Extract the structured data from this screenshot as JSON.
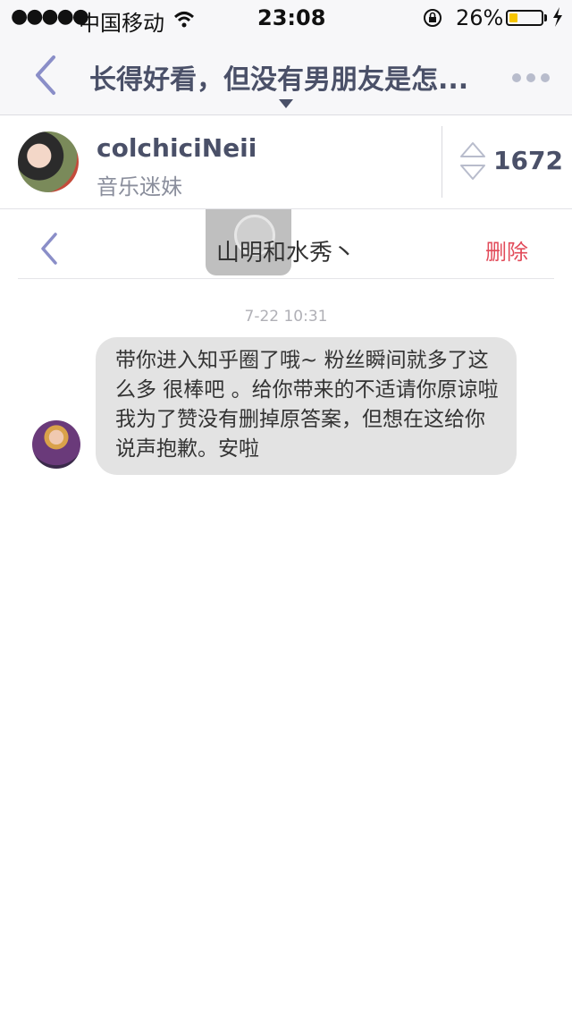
{
  "status_bar": {
    "signal": "●●●●●",
    "carrier": "中国移动",
    "time": "23:08",
    "battery_percent": "26%",
    "battery_level": 0.26,
    "icons": [
      "wifi-icon",
      "rotation-lock-icon",
      "battery-icon",
      "charging-icon"
    ]
  },
  "nav": {
    "title": "长得好看，但没有男朋友是怎...",
    "icons": [
      "back-chevron-icon",
      "caret-down-icon",
      "more-icon"
    ]
  },
  "author": {
    "name": "colchiciNeii",
    "bio": "音乐迷妹",
    "vote_count": "1672"
  },
  "message_sheet": {
    "recipient": "山明和水秀丶",
    "delete_label": "删除"
  },
  "conversation": {
    "timestamp": "7-22 10:31",
    "message": "带你进入知乎圈了哦~  粉丝瞬间就多了这么多  很棒吧 。给你带来的不适请你原谅啦   我为了赞没有删掉原答案，但想在这给你说声抱歉。安啦"
  },
  "colors": {
    "accent": "#8a8ec8",
    "delete": "#e24b5a",
    "bubble": "#e3e3e3",
    "battery": "#f5c400"
  }
}
